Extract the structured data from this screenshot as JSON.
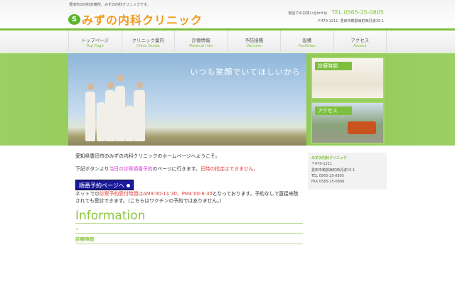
{
  "header": {
    "tagline": "豊田市の内科診療所、みずの内科クリニックです。",
    "logo_mark": "S",
    "logo_text": "みずの内科クリニック",
    "contact_label": "電話でのお問い合わせは",
    "tel": "TEL.0565-25-0805",
    "postal": "〒470-1211",
    "address": "豊田市鵜部東町西丹波15-1"
  },
  "nav": [
    {
      "jp": "トップページ",
      "en": "Top Page"
    },
    {
      "jp": "クリニック案内",
      "en": "Clinic Guide"
    },
    {
      "jp": "診療情報",
      "en": "Medical Info"
    },
    {
      "jp": "予防接種",
      "en": "Vaccine"
    },
    {
      "jp": "設備",
      "en": "Facilities"
    },
    {
      "jp": "アクセス",
      "en": "Access"
    }
  ],
  "hero": {
    "copy": "いつも笑顔でいてほしいから"
  },
  "side_cards": [
    {
      "label": "診療時間"
    },
    {
      "label": "アクセス"
    }
  ],
  "main": {
    "welcome": "愛知県豊田市のみずの内科クリニックのホームページへようこそ。",
    "p2_a": "下記ボタンより",
    "p2_pink": "当日の診察順番予約",
    "p2_b": "のページに行きます。",
    "p2_red": "日時の指定はできません。",
    "reserve_button": "順番予約ページへ",
    "p3_a": "ネットでの",
    "p3_red": "診察予約受付時間はAM9:00-11:30、PM4:00-6:30",
    "p3_b": "となっております。予約なしで直接来院されても受診できます。（こちらはワクチンの予約ではありません。）",
    "info_title": "Information",
    "bullet": "•",
    "subheading": "診察時間"
  },
  "sidebox": {
    "name": "みずの内科クリニック",
    "postal": "〒470-1211",
    "address": "豊田市鵜部東町西丹波15-1",
    "tel": "TEL 0565-25-0805",
    "fax": "FAX 0565-25-0806"
  },
  "colors": {
    "green": "#7fbf3f",
    "orange": "#f19a1d",
    "button": "#1a1a9a"
  }
}
